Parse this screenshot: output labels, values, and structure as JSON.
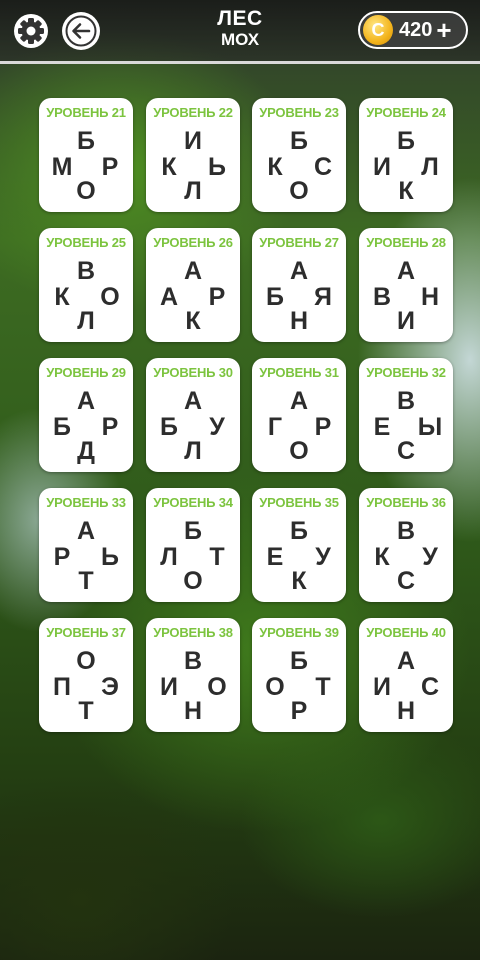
{
  "header": {
    "title": "ЛЕС",
    "subtitle": "МОХ",
    "coins": "420",
    "coin_symbol": "C",
    "plus_symbol": "+",
    "icons": [
      "gear-icon",
      "back-arrow-icon",
      "coin-icon",
      "plus-icon"
    ]
  },
  "colors": {
    "level_label": "#7cc43f",
    "letters": "#2d2d2d",
    "coin": "#f3b41c"
  },
  "levels": [
    {
      "label": "УРОВЕНЬ 21",
      "top": "Б",
      "left": "М",
      "right": "Р",
      "bottom": "О"
    },
    {
      "label": "УРОВЕНЬ 22",
      "top": "И",
      "left": "К",
      "right": "Ь",
      "bottom": "Л"
    },
    {
      "label": "УРОВЕНЬ 23",
      "top": "Б",
      "left": "К",
      "right": "С",
      "bottom": "О"
    },
    {
      "label": "УРОВЕНЬ 24",
      "top": "Б",
      "left": "И",
      "right": "Л",
      "bottom": "К"
    },
    {
      "label": "УРОВЕНЬ 25",
      "top": "В",
      "left": "К",
      "right": "О",
      "bottom": "Л"
    },
    {
      "label": "УРОВЕНЬ 26",
      "top": "А",
      "left": "А",
      "right": "Р",
      "bottom": "К"
    },
    {
      "label": "УРОВЕНЬ 27",
      "top": "А",
      "left": "Б",
      "right": "Я",
      "bottom": "Н"
    },
    {
      "label": "УРОВЕНЬ 28",
      "top": "А",
      "left": "В",
      "right": "Н",
      "bottom": "И"
    },
    {
      "label": "УРОВЕНЬ 29",
      "top": "А",
      "left": "Б",
      "right": "Р",
      "bottom": "Д"
    },
    {
      "label": "УРОВЕНЬ 30",
      "top": "А",
      "left": "Б",
      "right": "У",
      "bottom": "Л"
    },
    {
      "label": "УРОВЕНЬ 31",
      "top": "А",
      "left": "Г",
      "right": "Р",
      "bottom": "О"
    },
    {
      "label": "УРОВЕНЬ 32",
      "top": "В",
      "left": "Е",
      "right": "Ы",
      "bottom": "С"
    },
    {
      "label": "УРОВЕНЬ 33",
      "top": "А",
      "left": "Р",
      "right": "Ь",
      "bottom": "Т"
    },
    {
      "label": "УРОВЕНЬ 34",
      "top": "Б",
      "left": "Л",
      "right": "Т",
      "bottom": "О"
    },
    {
      "label": "УРОВЕНЬ 35",
      "top": "Б",
      "left": "Е",
      "right": "У",
      "bottom": "К"
    },
    {
      "label": "УРОВЕНЬ 36",
      "top": "В",
      "left": "К",
      "right": "У",
      "bottom": "С"
    },
    {
      "label": "УРОВЕНЬ 37",
      "top": "О",
      "left": "П",
      "right": "Э",
      "bottom": "Т"
    },
    {
      "label": "УРОВЕНЬ 38",
      "top": "В",
      "left": "И",
      "right": "О",
      "bottom": "Н"
    },
    {
      "label": "УРОВЕНЬ 39",
      "top": "Б",
      "left": "О",
      "right": "Т",
      "bottom": "Р"
    },
    {
      "label": "УРОВЕНЬ 40",
      "top": "А",
      "left": "И",
      "right": "С",
      "bottom": "Н"
    }
  ]
}
